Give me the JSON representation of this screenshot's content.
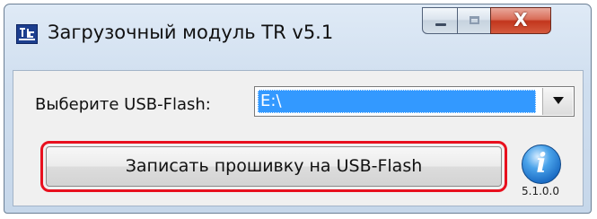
{
  "window": {
    "title": "Загрузочный модуль TR v5.1",
    "icon": "tr-app-icon"
  },
  "caption_buttons": {
    "minimize": "minimize-icon",
    "maximize": "maximize-icon",
    "close_label": "X"
  },
  "form": {
    "usb_label": "Выберите USB-Flash:",
    "usb_selected": "E:\\",
    "write_button_label": "Записать прошивку на USB-Flash",
    "version": "5.1.0.0"
  },
  "colors": {
    "selection": "#3399ff",
    "highlight_border": "#e8101e",
    "info_blue": "#1b6cc4"
  }
}
